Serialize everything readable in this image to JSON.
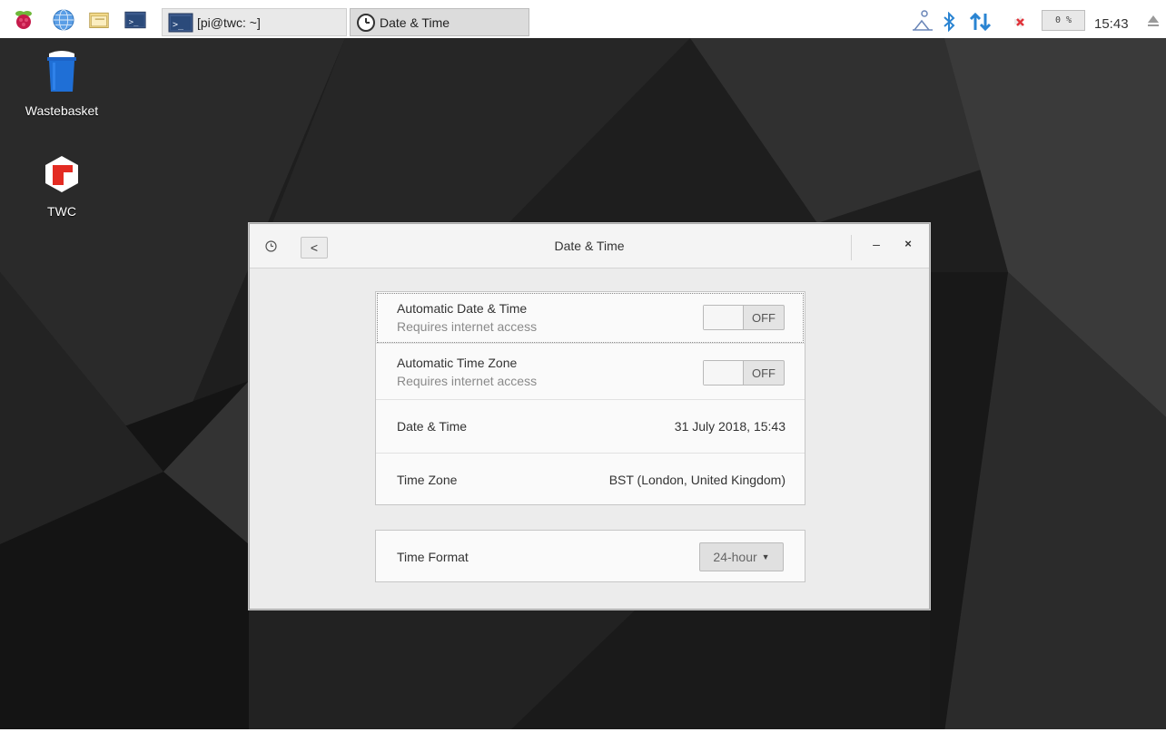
{
  "taskbar": {
    "launchers": [
      {
        "icon": "raspberry-menu-icon"
      },
      {
        "icon": "web-browser-icon"
      },
      {
        "icon": "file-manager-icon"
      },
      {
        "icon": "terminal-icon"
      }
    ],
    "tasks": [
      {
        "label": "[pi@twc: ~]",
        "icon": "terminal-icon"
      },
      {
        "label": "Date & Time",
        "icon": "clock-icon"
      }
    ],
    "tray": {
      "icons": [
        "accessibility-icon",
        "bluetooth-icon",
        "network-icon",
        "volume-muted-icon",
        "eject-icon"
      ],
      "cpu_label": "0 %",
      "clock": "15:43"
    }
  },
  "desktop": {
    "icons": [
      {
        "label": "Wastebasket",
        "icon": "trash-icon"
      },
      {
        "label": "TWC",
        "icon": "twc-app-icon"
      }
    ]
  },
  "dialog": {
    "title": "Date & Time",
    "back_symbol": "<",
    "minimize_symbol": "–",
    "close_symbol": "×",
    "rows": [
      {
        "title": "Automatic Date & Time",
        "subtitle": "Requires internet access",
        "toggle_state": "OFF"
      },
      {
        "title": "Automatic Time Zone",
        "subtitle": "Requires internet access",
        "toggle_state": "OFF"
      },
      {
        "title": "Date & Time",
        "value": "31 July 2018, 15:43"
      },
      {
        "title": "Time Zone",
        "value": "BST (London, United Kingdom)"
      }
    ],
    "time_format": {
      "label": "Time Format",
      "selected": "24-hour"
    }
  },
  "colors": {
    "accent_blue": "#2a84d2",
    "mute_red": "#e0333a",
    "twc_red": "#e32b22"
  }
}
